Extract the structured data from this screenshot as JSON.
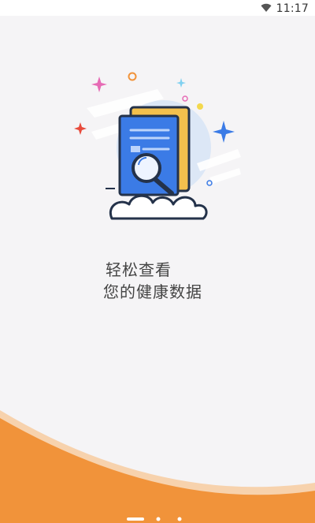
{
  "status_bar": {
    "time": "11:17",
    "wifi_icon": "wifi-icon"
  },
  "onboarding": {
    "headline_line1": "轻松查看",
    "headline_line2": "您的健康数据",
    "illustration_icon": "document-search-icon",
    "page_count": 3,
    "active_page": 1
  },
  "colors": {
    "background": "#f5f4f6",
    "accent_orange": "#f1933a",
    "document_blue": "#3b7be6",
    "document_yellow": "#f3c04d"
  }
}
